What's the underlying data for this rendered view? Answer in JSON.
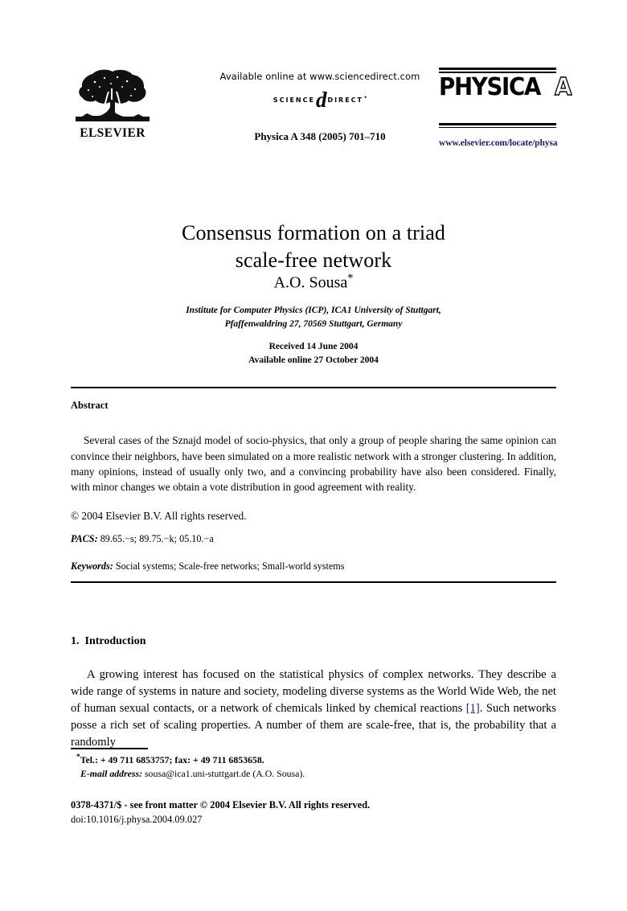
{
  "header": {
    "publisher_name": "ELSEVIER",
    "publisher_logo_icon": "elsevier-tree-icon",
    "available_online": "Available online at www.sciencedirect.com",
    "sciencedirect_word1": "SCIENCE",
    "sciencedirect_at": "d",
    "sciencedirect_word2": "DIRECT",
    "sciencedirect_star": "•",
    "journal_reference": "Physica A 348 (2005) 701–710",
    "journal_logo_main": "PHYSICA",
    "journal_logo_letter": "A",
    "journal_url": "www.elsevier.com/locate/physa",
    "journal_url_color": "#1a1a72"
  },
  "article": {
    "title_line1": "Consensus formation on a triad",
    "title_line2": "scale-free network",
    "author": "A.O. Sousa",
    "author_footnote_marker": "*",
    "affiliation_line1": "Institute for Computer Physics (ICP), ICA1 University of Stuttgart,",
    "affiliation_line2": "Pfaffenwaldring 27, 70569 Stuttgart, Germany",
    "received": "Received 14 June 2004",
    "available_online": "Available online 27 October 2004"
  },
  "abstract": {
    "heading": "Abstract",
    "body": "Several cases of the Sznajd model of socio-physics, that only a group of people sharing the same opinion can convince their neighbors, have been simulated on a more realistic network with a stronger clustering. In addition, many opinions, instead of usually only two, and a convincing probability have also been considered. Finally, with minor changes we obtain a vote distribution in good agreement with reality.",
    "copyright": "© 2004 Elsevier B.V. All rights reserved."
  },
  "pacs": {
    "label": "PACS:",
    "value": "89.65.−s; 89.75.−k; 05.10.−a"
  },
  "keywords": {
    "label": "Keywords:",
    "value": "Social systems; Scale-free networks; Small-world systems"
  },
  "introduction": {
    "number": "1.",
    "heading": "Introduction",
    "text_before_ref": "A growing interest has focused on the statistical physics of complex networks. They describe a wide range of systems in nature and society, modeling diverse systems as the World Wide Web, the net of human sexual contacts, or a network of chemicals linked by chemical reactions ",
    "reference_link": "[1]",
    "reference_link_color": "#1a1a8c",
    "text_after_ref": ". Such networks posse a rich set of scaling properties. A number of them are scale-free, that is, the probability that a randomly"
  },
  "footnote": {
    "marker": "*",
    "tel_fax": "Tel.: + 49 711 6853757; fax: + 49 711 6853658.",
    "email_label": "E-mail address:",
    "email_value": "sousa@ica1.uni-stuttgart.de (A.O. Sousa)."
  },
  "footer": {
    "front_matter": "0378-4371/$ - see front matter © 2004 Elsevier B.V. All rights reserved.",
    "doi": "doi:10.1016/j.physa.2004.09.027"
  }
}
